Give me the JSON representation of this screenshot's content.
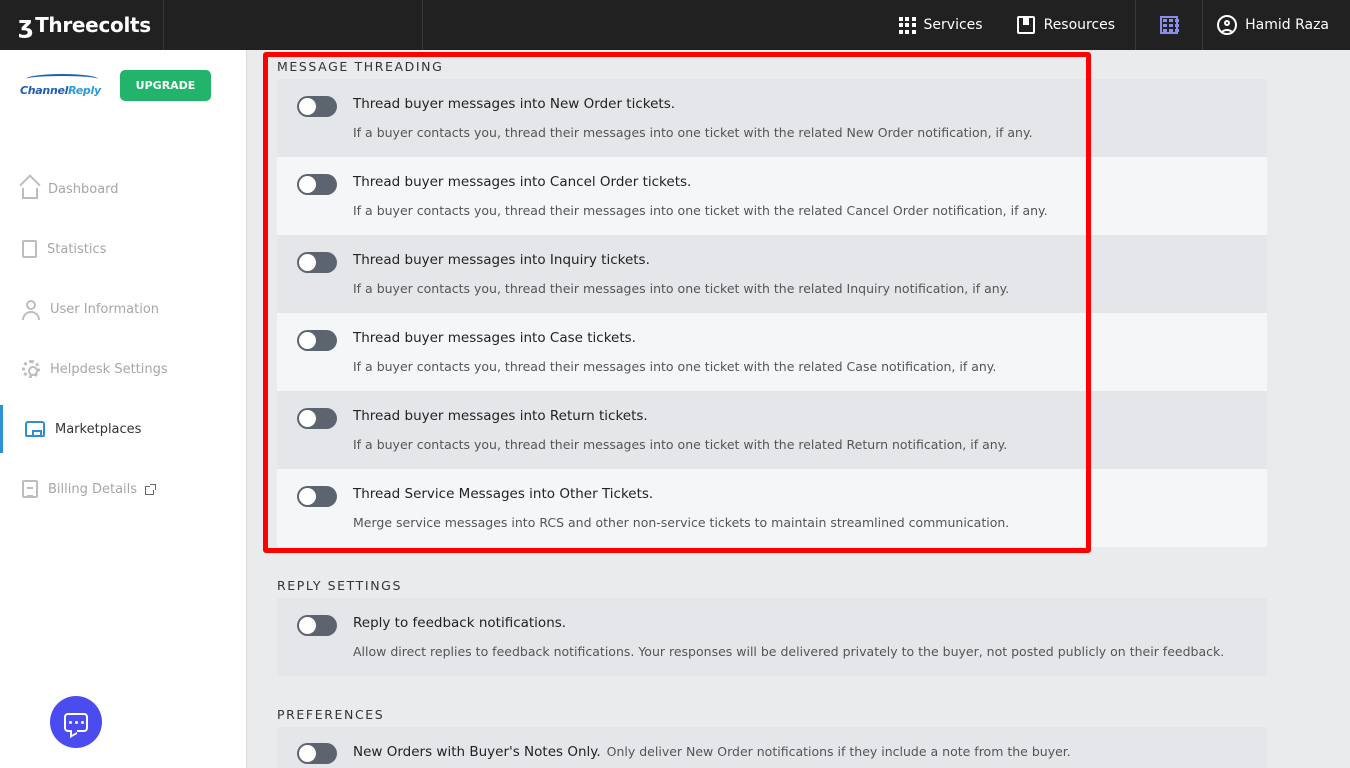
{
  "topbar": {
    "brand": "Threecolts",
    "services_label": "Services",
    "resources_label": "Resources",
    "user_name": "Hamid Raza"
  },
  "sidebar": {
    "logo_text_a": "Channel",
    "logo_text_b": "Reply",
    "upgrade_label": "UPGRADE",
    "items": [
      {
        "label": "Dashboard",
        "icon": "home-icon"
      },
      {
        "label": "Statistics",
        "icon": "clipboard-icon"
      },
      {
        "label": "User Information",
        "icon": "user-icon"
      },
      {
        "label": "Helpdesk Settings",
        "icon": "gear-icon"
      },
      {
        "label": "Marketplaces",
        "icon": "store-icon",
        "active": true
      },
      {
        "label": "Billing Details",
        "icon": "billing-icon"
      }
    ]
  },
  "sections": {
    "threading": {
      "title": "MESSAGE THREADING",
      "items": [
        {
          "title": "Thread buyer messages into New Order tickets.",
          "desc": "If a buyer contacts you, thread their messages into one ticket with the related New Order notification, if any.",
          "enabled": false
        },
        {
          "title": "Thread buyer messages into Cancel Order tickets.",
          "desc": "If a buyer contacts you, thread their messages into one ticket with the related Cancel Order notification, if any.",
          "enabled": false
        },
        {
          "title": "Thread buyer messages into Inquiry tickets.",
          "desc": "If a buyer contacts you, thread their messages into one ticket with the related Inquiry notification, if any.",
          "enabled": false
        },
        {
          "title": "Thread buyer messages into Case tickets.",
          "desc": "If a buyer contacts you, thread their messages into one ticket with the related Case notification, if any.",
          "enabled": false
        },
        {
          "title": "Thread buyer messages into Return tickets.",
          "desc": "If a buyer contacts you, thread their messages into one ticket with the related Return notification, if any.",
          "enabled": false
        },
        {
          "title": "Thread Service Messages into Other Tickets.",
          "desc": "Merge service messages into RCS and other non-service tickets to maintain streamlined communication.",
          "enabled": false
        }
      ]
    },
    "reply": {
      "title": "REPLY SETTINGS",
      "items": [
        {
          "title": "Reply to feedback notifications.",
          "desc": "Allow direct replies to feedback notifications. Your responses will be delivered privately to the buyer, not posted publicly on their feedback.",
          "enabled": false
        }
      ]
    },
    "preferences": {
      "title": "PREFERENCES",
      "items": [
        {
          "title": "New Orders with Buyer's Notes Only.",
          "desc": "Only deliver New Order notifications if they include a note from the buyer.",
          "enabled": false
        }
      ]
    }
  },
  "colors": {
    "highlight_border": "#ff0000",
    "upgrade_bg": "#23b46b",
    "chat_fab_bg": "#4b4cf0",
    "active_nav": "#2e8fd4"
  }
}
